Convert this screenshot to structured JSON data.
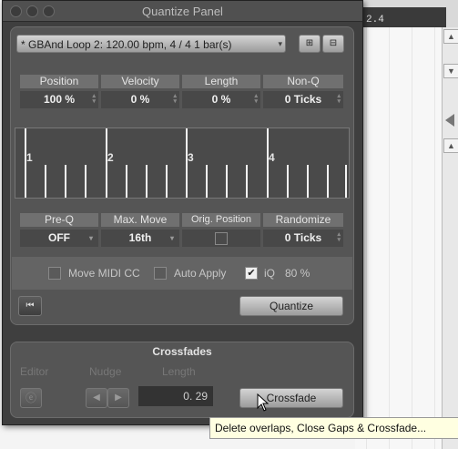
{
  "window": {
    "title": "Quantize Panel"
  },
  "background": {
    "ruler_marker": "2.4"
  },
  "preset": {
    "label": "* GBAnd Loop 2: 120.00 bpm, 4 / 4  1 bar(s)"
  },
  "params_top": [
    {
      "header": "Position",
      "value": "100 %"
    },
    {
      "header": "Velocity",
      "value": "0 %"
    },
    {
      "header": "Length",
      "value": "0 %"
    },
    {
      "header": "Non-Q",
      "value": "0 Ticks"
    }
  ],
  "grid": {
    "bars": [
      "1",
      "2",
      "3",
      "4"
    ]
  },
  "params_bottom": [
    {
      "header": "Pre-Q",
      "value": "OFF"
    },
    {
      "header": "Max. Move",
      "value": "16th"
    },
    {
      "header": "Orig. Position",
      "value": ""
    },
    {
      "header": "Randomize",
      "value": "0 Ticks"
    }
  ],
  "options": {
    "move_midi_cc": "Move MIDI CC",
    "auto_apply": "Auto Apply",
    "iq": "iQ",
    "iq_value": "80 %",
    "move_midi_cc_checked": false,
    "auto_apply_checked": false,
    "iq_checked": true
  },
  "quantize_button": "Quantize",
  "crossfades": {
    "title": "Crossfades",
    "editor_label": "Editor",
    "nudge_label": "Nudge",
    "length_label": "Length",
    "length_value": "0. 29",
    "button": "Crossfade"
  },
  "tooltip": "Delete overlaps, Close Gaps & Crossfade..."
}
